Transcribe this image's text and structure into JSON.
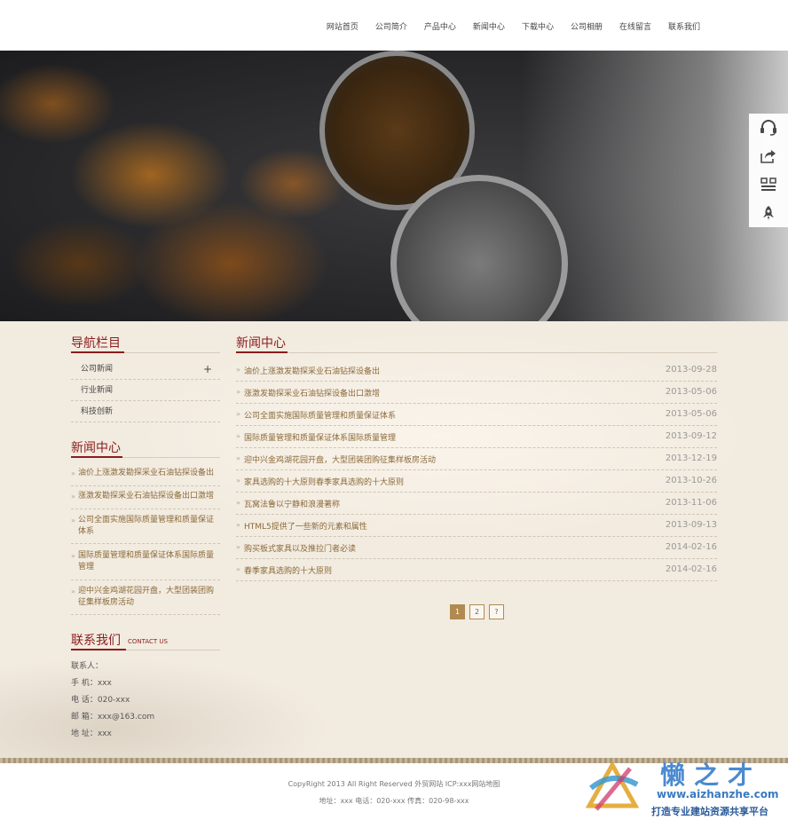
{
  "nav": {
    "items": [
      "网站首页",
      "公司简介",
      "产品中心",
      "新闻中心",
      "下载中心",
      "公司相册",
      "在线留言",
      "联系我们"
    ]
  },
  "sidebar_tools": [
    "headset-icon",
    "share-icon",
    "qrcode-icon",
    "rocket-icon"
  ],
  "left": {
    "nav_title": "导航栏目",
    "nav_items": [
      "公司新闻",
      "行业新闻",
      "科技创新"
    ],
    "nav_plus": "+",
    "news_title": "新闻中心",
    "news_items": [
      "油价上涨激发勘探采业石油钻探设备出",
      "涨激发勘探采业石油钻探设备出口激增",
      "公司全面实施国际质量管理和质量保证体系",
      "国际质量管理和质量保证体系国际质量管理",
      "迎中兴金鸡湖花园开盘，大型团装团购征集样板房活动"
    ],
    "contact_title": "联系我们",
    "contact_sub": "CONTACT US",
    "contact_lines": [
      "联系人：",
      "手  机：xxx",
      "电  话：020-xxx",
      "邮  箱：xxx@163.com",
      "地  址：xxx"
    ]
  },
  "main": {
    "title": "新闻中心",
    "news": [
      {
        "title": "油价上涨激发勘探采业石油钻探设备出",
        "date": "2013-09-28"
      },
      {
        "title": "涨激发勘探采业石油钻探设备出口激增",
        "date": "2013-05-06"
      },
      {
        "title": "公司全面实施国际质量管理和质量保证体系",
        "date": "2013-05-06"
      },
      {
        "title": "国际质量管理和质量保证体系国际质量管理",
        "date": "2013-09-12"
      },
      {
        "title": "迎中兴金鸡湖花园开盘，大型团装团购征集样板房活动",
        "date": "2013-12-19"
      },
      {
        "title": "家具选购的十大原则春季家具选购的十大原则",
        "date": "2013-10-26"
      },
      {
        "title": "瓦窝法鲁以宁静和浪漫著称",
        "date": "2013-11-06"
      },
      {
        "title": "HTML5提供了一些新的元素和属性",
        "date": "2013-09-13"
      },
      {
        "title": "购买板式家具以及推拉门者必读",
        "date": "2014-02-16"
      },
      {
        "title": "春季家具选购的十大原则",
        "date": "2014-02-16"
      }
    ],
    "pager": [
      "1",
      "2",
      "?"
    ]
  },
  "footer": {
    "line1": "CopyRight 2013 All Right Reserved 外贸网站 ICP:xxx网站地图",
    "line2": "地址：xxx  电话：020-xxx  传真：020-98-xxx"
  },
  "watermark": {
    "brand": "懒之才",
    "url": "www.aizhanzhe.com",
    "slogan": "打造专业建站资源共享平台"
  },
  "colors": {
    "accent": "#8b1d1d",
    "page_bg": "#f2ebe0",
    "pager_active": "#b08a50"
  }
}
